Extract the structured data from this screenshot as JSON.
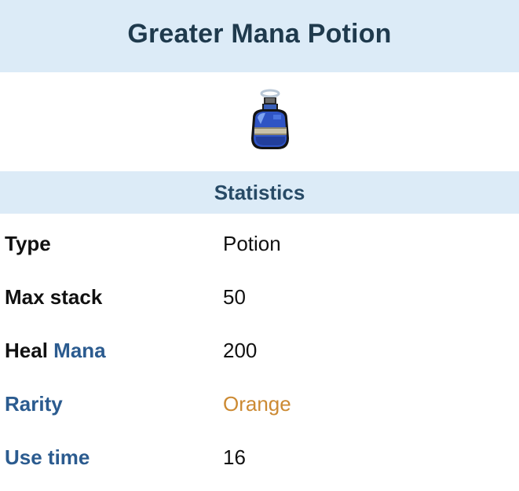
{
  "infobox": {
    "title": "Greater Mana Potion",
    "item_icon": "mana-potion-icon",
    "section_title": "Statistics",
    "stats": [
      {
        "label": "Type",
        "value": "Potion"
      },
      {
        "label": "Max stack",
        "value": "50"
      },
      {
        "label_prefix": "Heal",
        "label_link": "Mana",
        "value": "200"
      },
      {
        "label": "Rarity",
        "value": "Orange"
      },
      {
        "label": "Use time",
        "value": "16"
      }
    ],
    "colors": {
      "header_bg": "#dcebf7",
      "title_text": "#1f3a4d",
      "link_blue": "#2b5b8f",
      "rarity_orange": "#cc8a33"
    }
  }
}
